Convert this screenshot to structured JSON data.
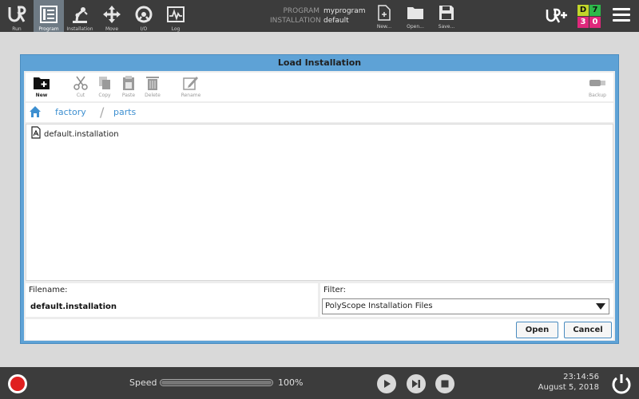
{
  "nav": {
    "items": [
      {
        "label": "Run"
      },
      {
        "label": "Program"
      },
      {
        "label": "Installation"
      },
      {
        "label": "Move"
      },
      {
        "label": "I/O"
      },
      {
        "label": "Log"
      }
    ]
  },
  "program_info": {
    "program_label": "PROGRAM",
    "program_name": "myprogram",
    "installation_label": "INSTALLATION",
    "installation_name": "default"
  },
  "file_tools": {
    "new_label": "New...",
    "open_label": "Open...",
    "save_label": "Save..."
  },
  "io_status": {
    "tiles": [
      {
        "text": "D",
        "color": "#c2d62a"
      },
      {
        "text": "7",
        "color": "#2db84a"
      },
      {
        "text": "3",
        "color": "#e0287c"
      },
      {
        "text": "0",
        "color": "#e0287c"
      }
    ]
  },
  "dialog": {
    "title": "Load Installation",
    "toolbar": {
      "new": "New",
      "cut": "Cut",
      "copy": "Copy",
      "paste": "Paste",
      "delete": "Delete",
      "rename": "Rename",
      "backup": "Backup"
    },
    "breadcrumb": {
      "items": [
        "factory",
        "parts"
      ]
    },
    "files": [
      {
        "name": "default.installation"
      }
    ],
    "filename_label": "Filename:",
    "filename_value": "default.installation",
    "filter_label": "Filter:",
    "filter_value": "PolyScope Installation Files",
    "open_button": "Open",
    "cancel_button": "Cancel"
  },
  "bottom": {
    "speed_label": "Speed",
    "speed_value": "100%",
    "speed_fraction": 1.0,
    "time": "23:14:56",
    "date": "August 5, 2018"
  },
  "colors": {
    "accent": "#3d8fd0",
    "dialog_frame": "#5ea2d6",
    "topbar": "#3c3c3c",
    "stop_red": "#e01f1f"
  }
}
